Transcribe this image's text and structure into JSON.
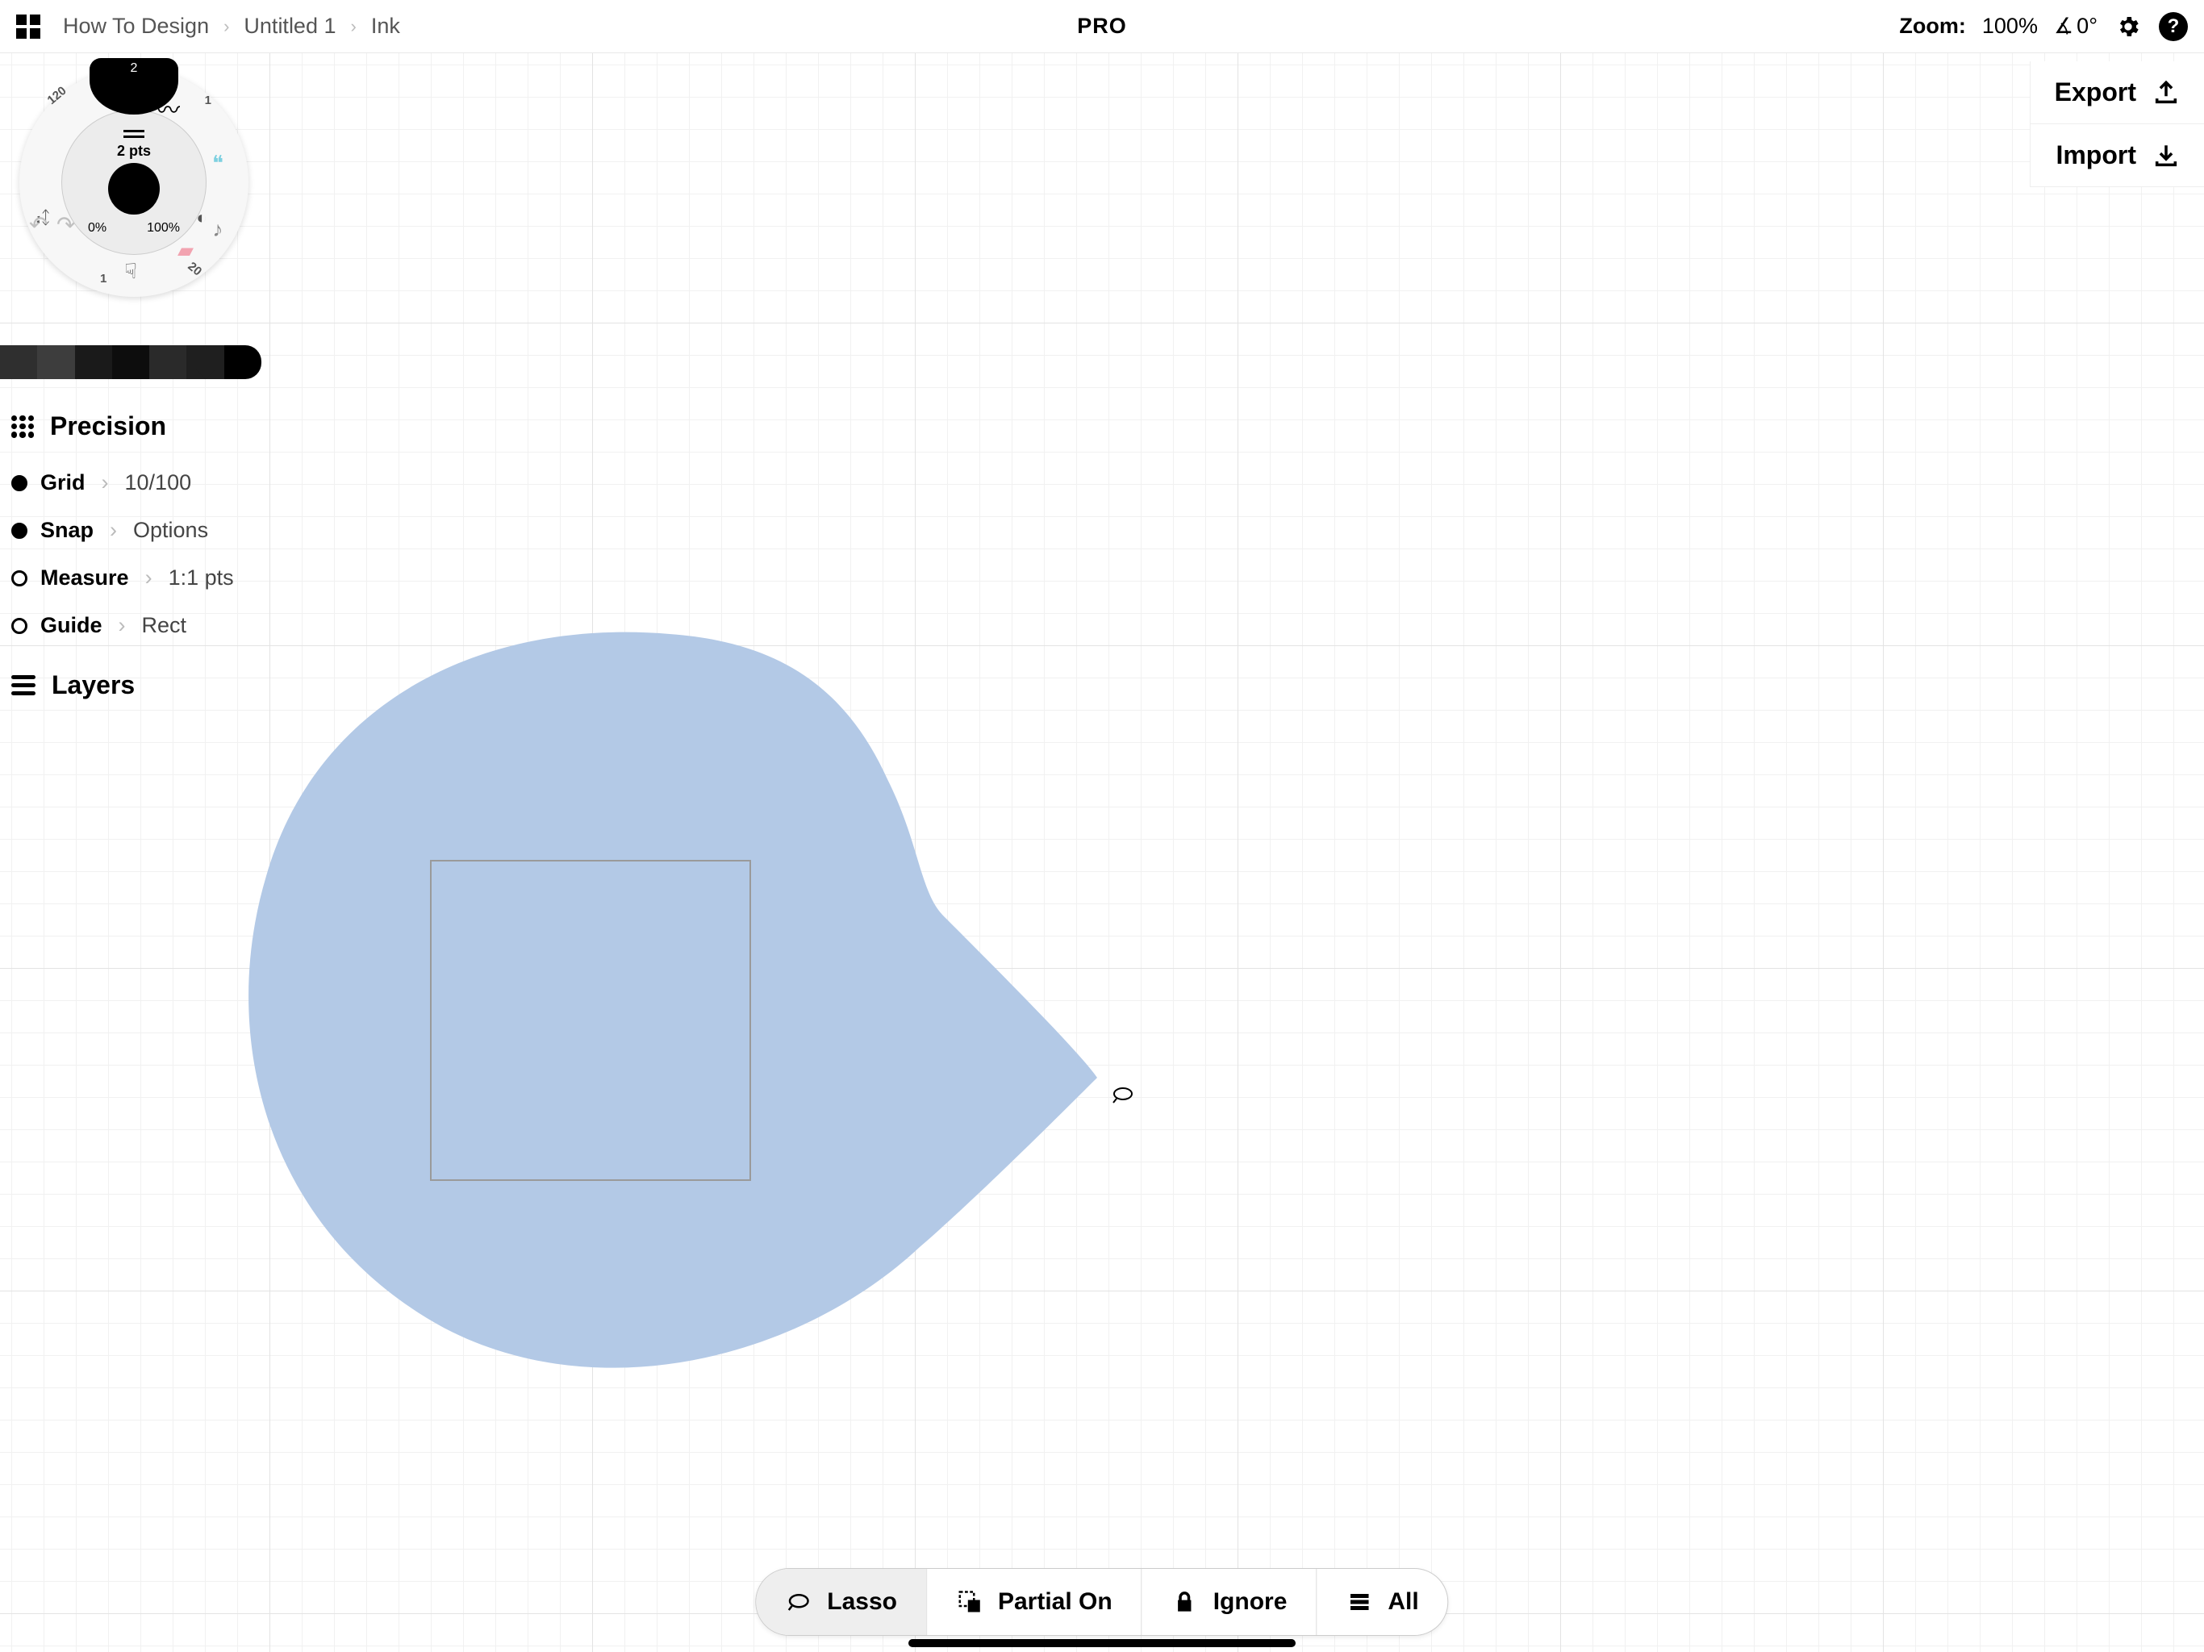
{
  "breadcrumbs": [
    "How To Design",
    "Untitled 1",
    "Ink"
  ],
  "badge": "PRO",
  "zoom": {
    "label": "Zoom:",
    "value": "100%",
    "angle": "0°"
  },
  "io": {
    "export": "Export",
    "import": "Import"
  },
  "wheel": {
    "top_badge": "2",
    "size_label": "2 pts",
    "pct_min": "0%",
    "pct_max": "100%",
    "outer_labels": {
      "a": "120",
      "b": "1",
      "c": "1",
      "d": "20"
    }
  },
  "palette": [
    "#2f2f2f",
    "#3d3d3d",
    "#1a1a1a",
    "#0d0d0d",
    "#2a2a2a",
    "#1f1f1f",
    "#000000"
  ],
  "sidebar": {
    "precision": {
      "title": "Precision",
      "rows": [
        {
          "name": "Grid",
          "value": "10/100",
          "filled": true
        },
        {
          "name": "Snap",
          "value": "Options",
          "filled": true
        },
        {
          "name": "Measure",
          "value": "1:1 pts",
          "filled": false
        },
        {
          "name": "Guide",
          "value": "Rect",
          "filled": false
        }
      ]
    },
    "layers": {
      "title": "Layers"
    }
  },
  "bottom": {
    "items": [
      {
        "label": "Lasso",
        "active": true
      },
      {
        "label": "Partial On",
        "active": false
      },
      {
        "label": "Ignore",
        "active": false
      },
      {
        "label": "All",
        "active": false
      }
    ]
  },
  "selection_color": "#b3c9e6"
}
